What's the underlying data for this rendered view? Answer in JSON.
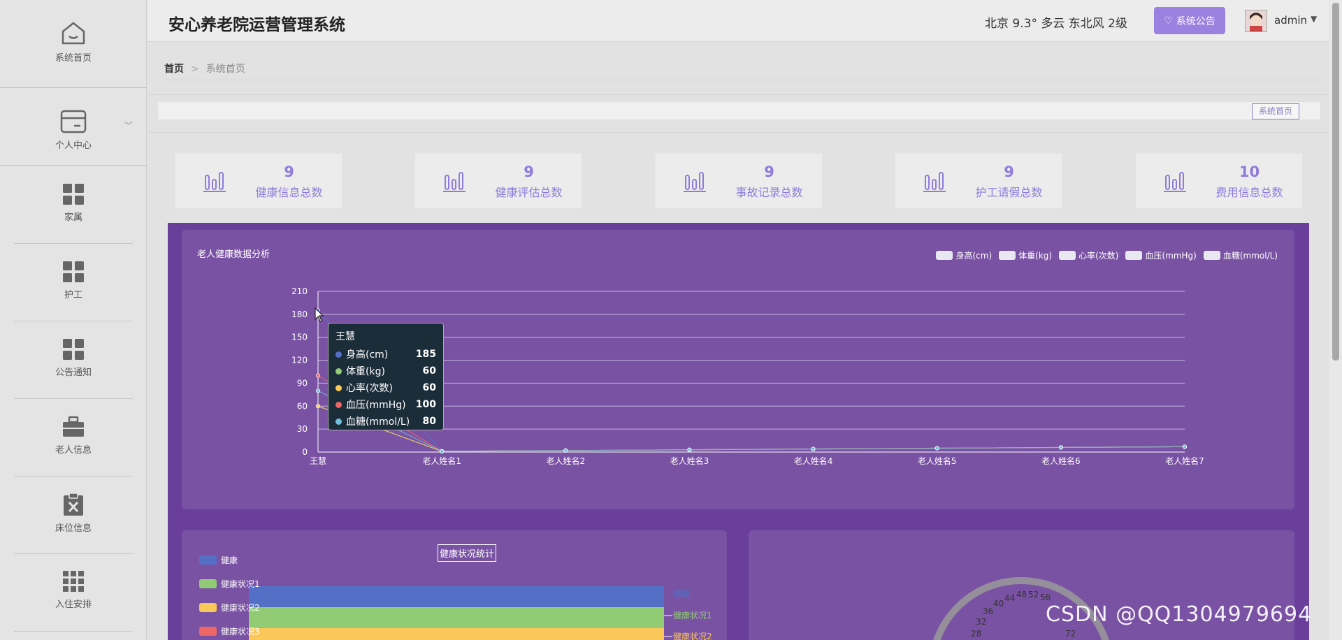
{
  "header": {
    "title": "安心养老院运营管理系统",
    "weather": "北京  9.3°  多云  东北风  2级",
    "notice_button": "系统公告",
    "user": "admin"
  },
  "sidebar": {
    "items": [
      {
        "label": "系统首页",
        "icon": "home-icon"
      },
      {
        "label": "个人中心",
        "icon": "card-icon"
      },
      {
        "label": "家属",
        "icon": "grid-icon"
      },
      {
        "label": "护工",
        "icon": "grid-icon"
      },
      {
        "label": "公告通知",
        "icon": "grid-icon"
      },
      {
        "label": "老人信息",
        "icon": "briefcase-icon"
      },
      {
        "label": "床位信息",
        "icon": "clipboard-x-icon"
      },
      {
        "label": "入住安排",
        "icon": "apps-grid-icon"
      }
    ]
  },
  "breadcrumb": {
    "home": "首页",
    "sep": ">",
    "current": "系统首页"
  },
  "tabs": {
    "active": "系统首页"
  },
  "stats": [
    {
      "value": "9",
      "label": "健康信息总数"
    },
    {
      "value": "9",
      "label": "健康评估总数"
    },
    {
      "value": "9",
      "label": "事故记录总数"
    },
    {
      "value": "9",
      "label": "护工请假总数"
    },
    {
      "value": "10",
      "label": "费用信息总数"
    }
  ],
  "line_chart": {
    "title": "老人健康数据分析"
  },
  "tooltip": {
    "name": "王慧",
    "rows": [
      {
        "label": "身高(cm)",
        "value": "185",
        "color": "#5470c6"
      },
      {
        "label": "体重(kg)",
        "value": "60",
        "color": "#91cc75"
      },
      {
        "label": "心率(次数)",
        "value": "60",
        "color": "#fac858"
      },
      {
        "label": "血压(mmHg)",
        "value": "100",
        "color": "#ee6666"
      },
      {
        "label": "血糖(mmol/L)",
        "value": "80",
        "color": "#73c0de"
      }
    ]
  },
  "bar_chart": {
    "title": "健康状况统计",
    "legend": [
      {
        "label": "健康",
        "color": "#5470c6"
      },
      {
        "label": "健康状况1",
        "color": "#91cc75"
      },
      {
        "label": "健康状况2",
        "color": "#fac858"
      },
      {
        "label": "健康状况3",
        "color": "#ee6666"
      }
    ],
    "right_labels": [
      "健康",
      "健康状况1",
      "健康状况2"
    ]
  },
  "gauge": {
    "ticks": [
      "28",
      "32",
      "36",
      "40",
      "44",
      "48",
      "52",
      "56",
      "72"
    ]
  },
  "watermark": "CSDN @QQ1304979694",
  "chart_data": [
    {
      "type": "line",
      "title": "老人健康数据分析",
      "categories": [
        "王慧",
        "老人姓名1",
        "老人姓名2",
        "老人姓名3",
        "老人姓名4",
        "老人姓名5",
        "老人姓名6",
        "老人姓名7"
      ],
      "ylim": [
        0,
        210
      ],
      "yticks": [
        0,
        30,
        60,
        90,
        120,
        150,
        180,
        210
      ],
      "series": [
        {
          "name": "身高(cm)",
          "color": "#5470c6",
          "values": [
            185,
            1,
            2,
            3,
            4,
            5,
            6,
            7
          ]
        },
        {
          "name": "体重(kg)",
          "color": "#91cc75",
          "values": [
            60,
            1,
            2,
            3,
            4,
            5,
            6,
            7
          ]
        },
        {
          "name": "心率(次数)",
          "color": "#fac858",
          "values": [
            60,
            1,
            2,
            3,
            4,
            5,
            6,
            7
          ]
        },
        {
          "name": "血压(mmHg)",
          "color": "#ee6666",
          "values": [
            100,
            1,
            2,
            3,
            4,
            5,
            6,
            7
          ]
        },
        {
          "name": "血糖(mmol/L)",
          "color": "#73c0de",
          "values": [
            80,
            1,
            2,
            3,
            4,
            5,
            6,
            7
          ]
        }
      ],
      "legend_position": "top-right",
      "grid": true
    }
  ]
}
